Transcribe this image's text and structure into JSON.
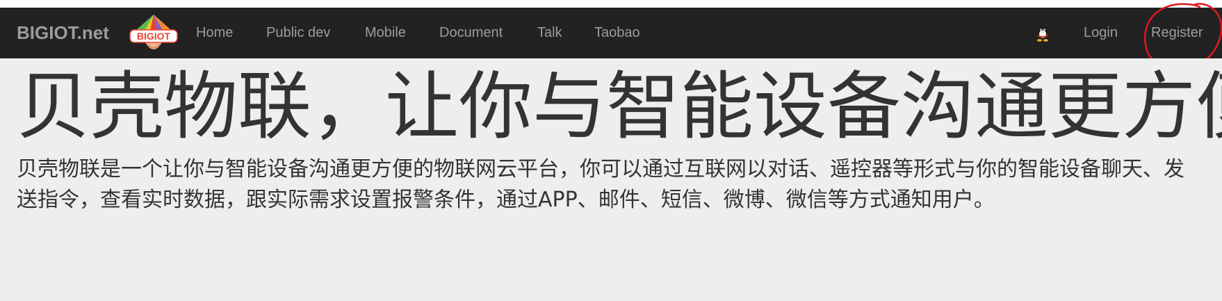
{
  "navbar": {
    "brand": "BIGIOT.net",
    "logo_text": "BIGIOT",
    "links": [
      {
        "label": "Home"
      },
      {
        "label": "Public dev"
      },
      {
        "label": "Mobile"
      },
      {
        "label": "Document"
      },
      {
        "label": "Talk"
      },
      {
        "label": "Taobao"
      }
    ],
    "qq_icon": "qq-penguin-icon",
    "login_label": "Login",
    "register_label": "Register"
  },
  "annotation": {
    "shape": "hand-drawn-ellipse",
    "color": "#e0181e"
  },
  "colors": {
    "navbar_bg": "#222222",
    "nav_text": "#9d9d9d",
    "hero_bg": "#eeeeee",
    "hero_text": "#333333"
  },
  "hero": {
    "headline": "贝壳物联，让你与智能设备沟通更方便",
    "description": "贝壳物联是一个让你与智能设备沟通更方便的物联网云平台，你可以通过互联网以对话、遥控器等形式与你的智能设备聊天、发送指令，查看实时数据，跟实际需求设置报警条件，通过APP、邮件、短信、微博、微信等方式通知用户。"
  }
}
